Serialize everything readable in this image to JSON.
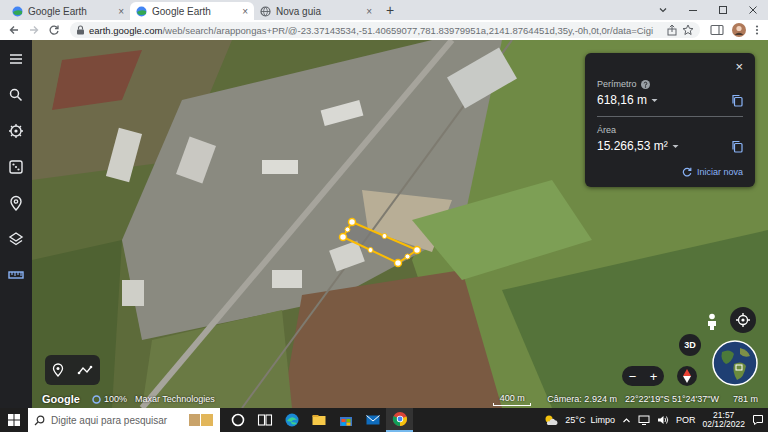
{
  "browser": {
    "tabs": [
      {
        "label": "Google Earth",
        "close": "×",
        "kind": "earth",
        "selected": false
      },
      {
        "label": "Google Earth",
        "close": "×",
        "kind": "earth",
        "selected": true
      },
      {
        "label": "Nova guia",
        "close": "×",
        "kind": "newtab",
        "selected": false
      }
    ],
    "new_tab": "+",
    "url_host": "earth.google.com",
    "url_path": "/web/search/arappongas+PR/@-23.37143534,-51.40659077,781.83979951a,2141.8764451d,35y,-0h,0t,0r/data=Cigi"
  },
  "rail": [
    {
      "kind": "menu",
      "selected": false
    },
    {
      "kind": "search",
      "selected": false
    },
    {
      "kind": "voyager",
      "selected": false
    },
    {
      "kind": "dice",
      "selected": false
    },
    {
      "kind": "pin",
      "selected": false
    },
    {
      "kind": "layers",
      "selected": false
    },
    {
      "kind": "ruler",
      "selected": true
    }
  ],
  "measure": {
    "close": "×",
    "perimeter_label": "Perímetro",
    "perimeter": "618,16 m",
    "area_label": "Área",
    "area": "15.266,53 m²",
    "new_button": "Iniciar nova"
  },
  "controls": {
    "view_3d": "3D",
    "zoom_out": "−",
    "zoom_in": "+"
  },
  "footer": {
    "logo": "Google",
    "zoom": "100%",
    "credit": "Maxar Technologies",
    "scale": "400 m",
    "camera": "Câmera: 2.924 m",
    "coords": "22°22'19\"S 51°24'37\"W",
    "altitude": "781 m"
  },
  "taskbar": {
    "search_placeholder": "Digite aqui para pesquisar",
    "apps": [
      {
        "kind": "cortana",
        "active": false
      },
      {
        "kind": "taskview",
        "active": false
      },
      {
        "kind": "edge",
        "active": false
      },
      {
        "kind": "explorer",
        "active": false
      },
      {
        "kind": "store",
        "active": false
      },
      {
        "kind": "mail",
        "active": false
      },
      {
        "kind": "chrome",
        "active": true
      }
    ],
    "temperature": "25°C",
    "condition": "Limpo",
    "language": "POR",
    "time": "21:57",
    "date": "02/12/2022"
  }
}
